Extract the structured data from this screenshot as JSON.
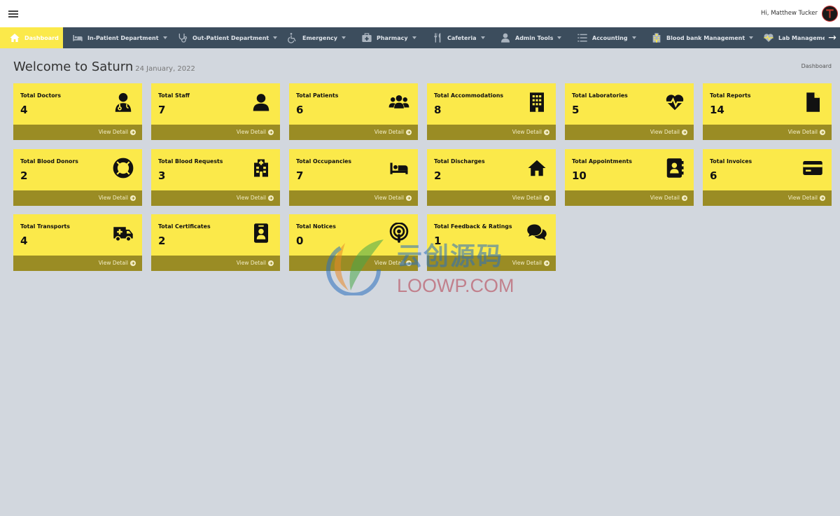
{
  "user": {
    "greeting": "Hi, Matthew Tucker"
  },
  "nav": {
    "items": [
      {
        "label": "Dashboard",
        "icon": "home-icon",
        "active": true,
        "caret": false
      },
      {
        "label": "In-Patient Department",
        "icon": "bed-icon",
        "active": false,
        "caret": true
      },
      {
        "label": "Out-Patient Department",
        "icon": "stethoscope-icon",
        "active": false,
        "caret": true
      },
      {
        "label": "Emergency",
        "icon": "wheelchair-icon",
        "active": false,
        "caret": true
      },
      {
        "label": "Pharmacy",
        "icon": "medkit-icon",
        "active": false,
        "caret": true
      },
      {
        "label": "Cafeteria",
        "icon": "utensils-icon",
        "active": false,
        "caret": true
      },
      {
        "label": "Admin Tools",
        "icon": "user-icon",
        "active": false,
        "caret": true
      },
      {
        "label": "Accounting",
        "icon": "list-icon",
        "active": false,
        "caret": true
      },
      {
        "label": "Blood bank Management",
        "icon": "hospital-icon",
        "active": false,
        "caret": true
      },
      {
        "label": "Lab Management",
        "icon": "heartbeat-icon",
        "active": false,
        "caret": true
      }
    ]
  },
  "header": {
    "title": "Welcome to Saturn",
    "date": "24 January, 2022",
    "breadcrumb": "Dashboard"
  },
  "cards": [
    {
      "label": "Total Doctors",
      "value": "4",
      "icon": "doctor-icon",
      "link": "View Detail"
    },
    {
      "label": "Total Staff",
      "value": "7",
      "icon": "user-icon",
      "link": "View Detail"
    },
    {
      "label": "Total Patients",
      "value": "6",
      "icon": "users-icon",
      "link": "View Detail"
    },
    {
      "label": "Total Accommodations",
      "value": "8",
      "icon": "building-icon",
      "link": "View Detail"
    },
    {
      "label": "Total Laboratories",
      "value": "5",
      "icon": "heartbeat-icon",
      "link": "View Detail"
    },
    {
      "label": "Total Reports",
      "value": "14",
      "icon": "file-icon",
      "link": "View Detail"
    },
    {
      "label": "Total Blood Donors",
      "value": "2",
      "icon": "life-ring-icon",
      "link": "View Detail"
    },
    {
      "label": "Total Blood Requests",
      "value": "3",
      "icon": "hospital-icon",
      "link": "View Detail"
    },
    {
      "label": "Total Occupancies",
      "value": "7",
      "icon": "bed-icon",
      "link": "View Detail"
    },
    {
      "label": "Total Discharges",
      "value": "2",
      "icon": "home-icon",
      "link": "View Detail"
    },
    {
      "label": "Total Appointments",
      "value": "10",
      "icon": "address-book-icon",
      "link": "View Detail"
    },
    {
      "label": "Total Invoices",
      "value": "6",
      "icon": "credit-card-icon",
      "link": "View Detail"
    },
    {
      "label": "Total Transports",
      "value": "4",
      "icon": "ambulance-icon",
      "link": "View Detail"
    },
    {
      "label": "Total Certificates",
      "value": "2",
      "icon": "id-badge-icon",
      "link": "View Detail"
    },
    {
      "label": "Total Notices",
      "value": "0",
      "icon": "podcast-icon",
      "link": "View Detail"
    },
    {
      "label": "Total Feedback & Ratings",
      "value": "1",
      "icon": "comments-icon",
      "link": "View Detail"
    }
  ],
  "watermark": {
    "cn": "云创源码",
    "en": "LOOWP.COM"
  },
  "colors": {
    "card": "#fbe94a",
    "card_footer": "#9a8c24",
    "navbar": "#3c4d5d",
    "background": "#d2d7de"
  }
}
